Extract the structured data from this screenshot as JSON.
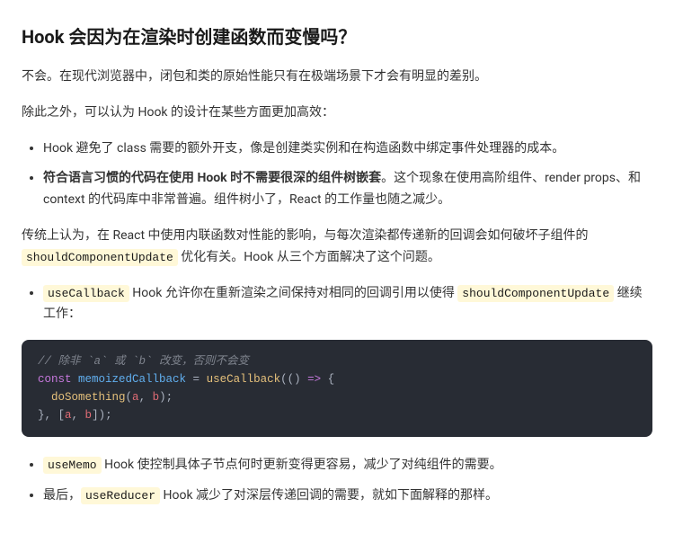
{
  "heading": "Hook 会因为在渲染时创建函数而变慢吗？",
  "p1": "不会。在现代浏览器中，闭包和类的原始性能只有在极端场景下才会有明显的差别。",
  "p2": "除此之外，可以认为 Hook 的设计在某些方面更加高效：",
  "list1": {
    "item1": "Hook 避免了 class 需要的额外开支，像是创建类实例和在构造函数中绑定事件处理器的成本。",
    "item2_bold": "符合语言习惯的代码在使用 Hook 时不需要很深的组件树嵌套",
    "item2_rest": "。这个现象在使用高阶组件、render props、和 context 的代码库中非常普遍。组件树小了，React 的工作量也随之减少。"
  },
  "p3_a": "传统上认为，在 React 中使用内联函数对性能的影响，与每次渲染都传递新的回调会如何破坏子组件的 ",
  "p3_code": "shouldComponentUpdate",
  "p3_b": " 优化有关。Hook 从三个方面解决了这个问题。",
  "list2": {
    "item1_code": "useCallback",
    "item1_a": " Hook 允许你在重新渲染之间保持对相同的回调引用以使得 ",
    "item1_code2": "shouldComponentUpdate",
    "item1_b": " 继续工作：",
    "item2_code": "useMemo",
    "item2_text": " Hook 使控制具体子节点何时更新变得更容易，减少了对纯组件的需要。",
    "item3_a": "最后，",
    "item3_code": "useReducer",
    "item3_b": " Hook 减少了对深层传递回调的需要，就如下面解释的那样。"
  },
  "code": {
    "c1": "// 除非 `a` 或 `b` 改变，否则不会变",
    "kw_const": "const",
    "def": " memoizedCallback ",
    "eq": "= ",
    "fn_useCallback": "useCallback",
    "lp1": "(() ",
    "arrow": "=>",
    "lb1": " {",
    "indent": "  ",
    "fn_doSomething": "doSomething",
    "lp2": "(",
    "a": "a",
    "comma1": ", ",
    "b": "b",
    "rp2": ");",
    "rb1": "}, [",
    "a2": "a",
    "comma2": ", ",
    "b2": "b",
    "end": "]);"
  }
}
